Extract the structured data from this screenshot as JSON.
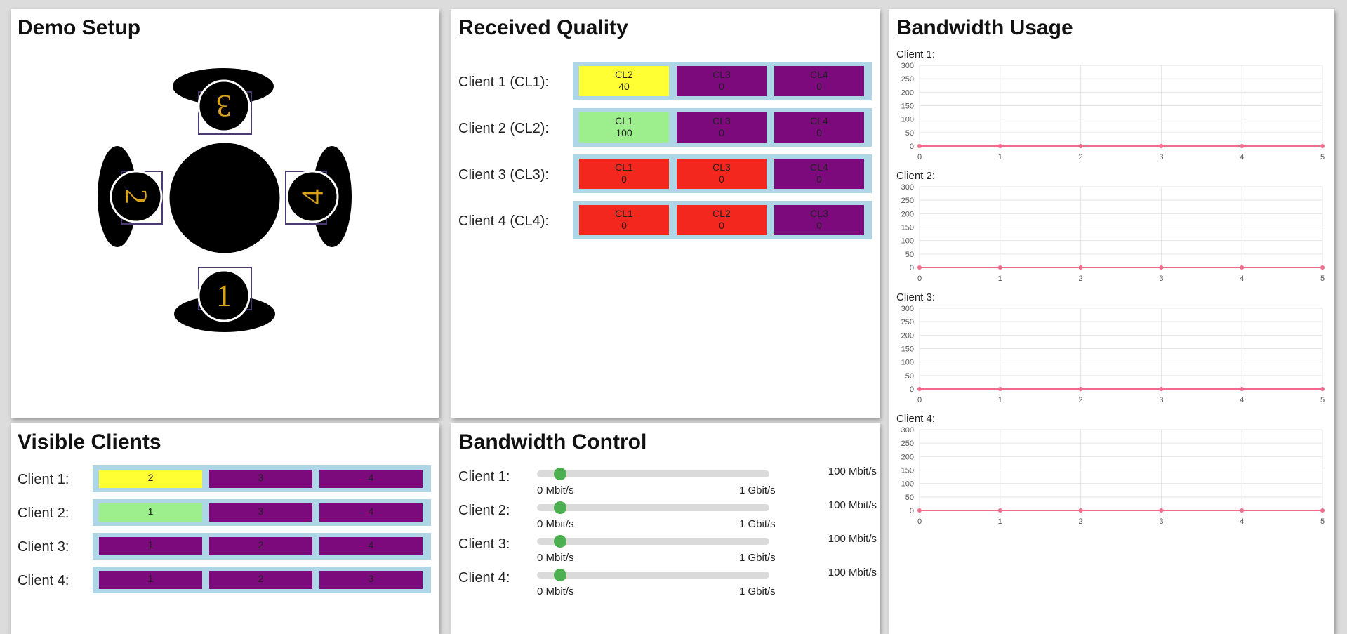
{
  "setup": {
    "title": "Demo Setup",
    "seats": [
      "1",
      "2",
      "3",
      "4"
    ]
  },
  "quality": {
    "title": "Received Quality",
    "rows": [
      {
        "label": "Client 1 (CL1):",
        "cells": [
          {
            "name": "CL2",
            "value": "40",
            "color": "#ffff33"
          },
          {
            "name": "CL3",
            "value": "0",
            "color": "#7c0a7c"
          },
          {
            "name": "CL4",
            "value": "0",
            "color": "#7c0a7c"
          }
        ]
      },
      {
        "label": "Client 2 (CL2):",
        "cells": [
          {
            "name": "CL1",
            "value": "100",
            "color": "#9cef8c"
          },
          {
            "name": "CL3",
            "value": "0",
            "color": "#7c0a7c"
          },
          {
            "name": "CL4",
            "value": "0",
            "color": "#7c0a7c"
          }
        ]
      },
      {
        "label": "Client 3 (CL3):",
        "cells": [
          {
            "name": "CL1",
            "value": "0",
            "color": "#f4271e"
          },
          {
            "name": "CL3",
            "value": "0",
            "color": "#f4271e"
          },
          {
            "name": "CL4",
            "value": "0",
            "color": "#7c0a7c"
          }
        ]
      },
      {
        "label": "Client 4 (CL4):",
        "cells": [
          {
            "name": "CL1",
            "value": "0",
            "color": "#f4271e"
          },
          {
            "name": "CL2",
            "value": "0",
            "color": "#f4271e"
          },
          {
            "name": "CL3",
            "value": "0",
            "color": "#7c0a7c"
          }
        ]
      }
    ]
  },
  "visible": {
    "title": "Visible Clients",
    "rows": [
      {
        "label": "Client 1:",
        "cells": [
          {
            "text": "2",
            "color": "#ffff33"
          },
          {
            "text": "3",
            "color": "#7c0a7c"
          },
          {
            "text": "4",
            "color": "#7c0a7c"
          }
        ]
      },
      {
        "label": "Client 2:",
        "cells": [
          {
            "text": "1",
            "color": "#9cef8c"
          },
          {
            "text": "3",
            "color": "#7c0a7c"
          },
          {
            "text": "4",
            "color": "#7c0a7c"
          }
        ]
      },
      {
        "label": "Client 3:",
        "cells": [
          {
            "text": "1",
            "color": "#7c0a7c"
          },
          {
            "text": "2",
            "color": "#7c0a7c"
          },
          {
            "text": "4",
            "color": "#7c0a7c"
          }
        ]
      },
      {
        "label": "Client 4:",
        "cells": [
          {
            "text": "1",
            "color": "#7c0a7c"
          },
          {
            "text": "2",
            "color": "#7c0a7c"
          },
          {
            "text": "3",
            "color": "#7c0a7c"
          }
        ]
      }
    ]
  },
  "bwctrl": {
    "title": "Bandwidth Control",
    "rows": [
      {
        "label": "Client 1:",
        "value": "100 Mbit/s",
        "min": "0 Mbit/s",
        "max": "1 Gbit/s",
        "fraction": 0.1
      },
      {
        "label": "Client 2:",
        "value": "100 Mbit/s",
        "min": "0 Mbit/s",
        "max": "1 Gbit/s",
        "fraction": 0.1
      },
      {
        "label": "Client 3:",
        "value": "100 Mbit/s",
        "min": "0 Mbit/s",
        "max": "1 Gbit/s",
        "fraction": 0.1
      },
      {
        "label": "Client 4:",
        "value": "100 Mbit/s",
        "min": "0 Mbit/s",
        "max": "1 Gbit/s",
        "fraction": 0.1
      }
    ]
  },
  "usage": {
    "title": "Bandwidth Usage",
    "line_color": "#f06c8a"
  },
  "chart_data": [
    {
      "type": "line",
      "title": "Client 1:",
      "x": [
        0,
        1,
        2,
        3,
        4,
        5
      ],
      "series": [
        {
          "values": [
            0,
            0,
            0,
            0,
            0,
            0
          ]
        }
      ],
      "xlim": [
        0,
        5
      ],
      "ylim": [
        0,
        300
      ],
      "yticks": [
        0,
        50,
        100,
        150,
        200,
        250,
        300
      ],
      "xticks": [
        0,
        1,
        2,
        3,
        4,
        5
      ],
      "grid": true
    },
    {
      "type": "line",
      "title": "Client 2:",
      "x": [
        0,
        1,
        2,
        3,
        4,
        5
      ],
      "series": [
        {
          "values": [
            0,
            0,
            0,
            0,
            0,
            0
          ]
        }
      ],
      "xlim": [
        0,
        5
      ],
      "ylim": [
        0,
        300
      ],
      "yticks": [
        0,
        50,
        100,
        150,
        200,
        250,
        300
      ],
      "xticks": [
        0,
        1,
        2,
        3,
        4,
        5
      ],
      "grid": true
    },
    {
      "type": "line",
      "title": "Client 3:",
      "x": [
        0,
        1,
        2,
        3,
        4,
        5
      ],
      "series": [
        {
          "values": [
            0,
            0,
            0,
            0,
            0,
            0
          ]
        }
      ],
      "xlim": [
        0,
        5
      ],
      "ylim": [
        0,
        300
      ],
      "yticks": [
        0,
        50,
        100,
        150,
        200,
        250,
        300
      ],
      "xticks": [
        0,
        1,
        2,
        3,
        4,
        5
      ],
      "grid": true
    },
    {
      "type": "line",
      "title": "Client 4:",
      "x": [
        0,
        1,
        2,
        3,
        4,
        5
      ],
      "series": [
        {
          "values": [
            0,
            0,
            0,
            0,
            0,
            0
          ]
        }
      ],
      "xlim": [
        0,
        5
      ],
      "ylim": [
        0,
        300
      ],
      "yticks": [
        0,
        50,
        100,
        150,
        200,
        250,
        300
      ],
      "xticks": [
        0,
        1,
        2,
        3,
        4,
        5
      ],
      "grid": true
    }
  ]
}
